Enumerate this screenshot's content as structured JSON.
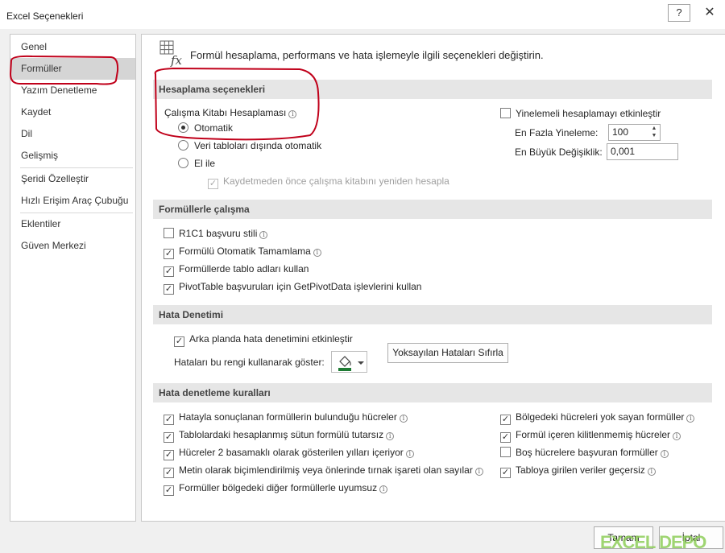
{
  "window": {
    "title": "Excel Seçenekleri",
    "help_glyph": "?",
    "close_glyph": "✕"
  },
  "nav": {
    "items": [
      {
        "label": "Genel"
      },
      {
        "label": "Formüller"
      },
      {
        "label": "Yazım Denetleme"
      },
      {
        "label": "Kaydet"
      },
      {
        "label": "Dil"
      },
      {
        "label": "Gelişmiş"
      },
      {
        "label": "Şeridi Özelleştir"
      },
      {
        "label": "Hızlı Erişim Araç Çubuğu"
      },
      {
        "label": "Eklentiler"
      },
      {
        "label": "Güven Merkezi"
      }
    ],
    "active": "Formüller"
  },
  "intro": {
    "text": "Formül hesaplama, performans ve hata işlemeyle ilgili seçenekleri değiştirin."
  },
  "calc": {
    "heading": "Hesaplama seçenekleri",
    "workbook_label": "Çalışma Kitabı Hesaplaması",
    "options": [
      {
        "label": "Otomatik",
        "selected": true
      },
      {
        "label": "Veri tabloları dışında otomatik",
        "selected": false
      },
      {
        "label": "El ile",
        "selected": false
      }
    ],
    "recalc_label": "Kaydetmeden önce çalışma kitabını yeniden hesapla",
    "iterative_label": "Yinelemeli hesaplamayı etkinleştir",
    "max_iter_label": "En Fazla Yineleme:",
    "max_iter_value": "100",
    "max_change_label": "En Büyük Değişiklik:",
    "max_change_value": "0,001"
  },
  "formulas": {
    "heading": "Formüllerle çalışma",
    "items": [
      {
        "label": "R1C1 başvuru stili",
        "checked": false,
        "info": true
      },
      {
        "label": "Formülü Otomatik Tamamlama",
        "checked": true,
        "info": true
      },
      {
        "label": "Formüllerde tablo adları kullan",
        "checked": true,
        "info": false
      },
      {
        "label": "PivotTable başvuruları için GetPivotData işlevlerini kullan",
        "checked": true,
        "info": false
      }
    ]
  },
  "errors": {
    "heading": "Hata Denetimi",
    "background_label": "Arka planda hata denetimini etkinleştir",
    "color_label": "Hataları bu rengi kullanarak göster:",
    "reset_button": "Yoksayılan Hataları Sıfırla"
  },
  "rules": {
    "heading": "Hata denetleme kuralları",
    "left": [
      {
        "label": "Hatayla sonuçlanan formüllerin bulunduğu hücreler",
        "checked": true
      },
      {
        "label": "Tablolardaki hesaplanmış sütun formülü tutarsız",
        "checked": true
      },
      {
        "label": "Hücreler 2 basamaklı olarak gösterilen yılları içeriyor",
        "checked": true
      },
      {
        "label": "Metin olarak biçimlendirilmiş veya önlerinde tırnak işareti olan sayılar",
        "checked": true
      },
      {
        "label": "Formüller bölgedeki diğer formüllerle uyumsuz",
        "checked": true
      }
    ],
    "right": [
      {
        "label": "Bölgedeki hücreleri yok sayan formüller",
        "checked": true
      },
      {
        "label": "Formül içeren kilitlenmemiş hücreler",
        "checked": true
      },
      {
        "label": "Boş hücrelere başvuran formüller",
        "checked": false
      },
      {
        "label": "Tabloya girilen veriler geçersiz",
        "checked": true
      }
    ]
  },
  "footer": {
    "ok_label": "Tamam",
    "cancel_label": "İptal",
    "watermark": "EXCEL DEPO"
  },
  "colors": {
    "annotation": "#c0001a",
    "error_color": "#1e7b34"
  }
}
